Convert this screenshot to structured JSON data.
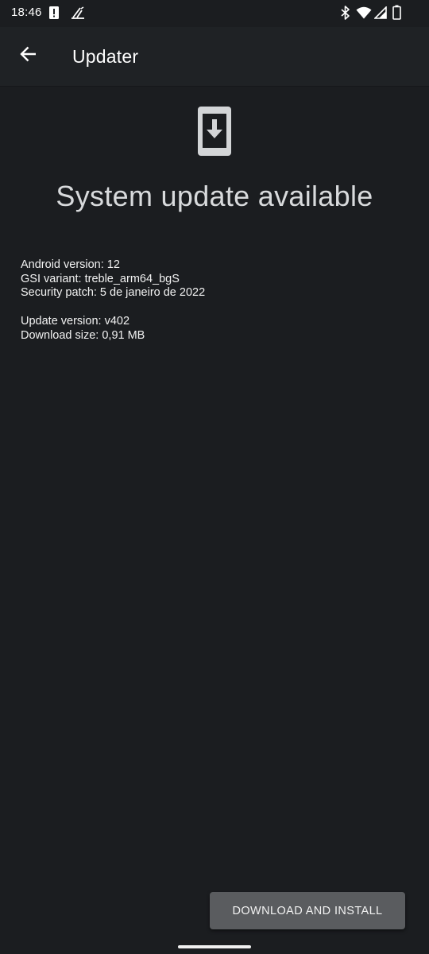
{
  "status_bar": {
    "time": "18:46",
    "icons": [
      "alert-icon",
      "app-notification-icon",
      "bluetooth-icon",
      "wifi-icon",
      "cellular-signal-icon",
      "battery-icon"
    ]
  },
  "toolbar": {
    "title": "Updater",
    "back_icon": "arrow-back-icon"
  },
  "main": {
    "hero_icon": "phone-download-icon",
    "headline": "System update available",
    "build_info": {
      "android_version": "Android version: 12",
      "gsi_variant": "GSI variant: treble_arm64_bgS",
      "security_patch": "Security patch: 5 de janeiro de 2022"
    },
    "update_info": {
      "update_version": "Update version: v402",
      "download_size": "Download size: 0,91 MB"
    }
  },
  "actions": {
    "download_install_label": "DOWNLOAD AND INSTALL"
  },
  "colors": {
    "background": "#1b1d20",
    "toolbar": "#1f2225",
    "button": "#5a5c5f",
    "text": "#f2f2f2",
    "headline": "#d8dadc"
  }
}
